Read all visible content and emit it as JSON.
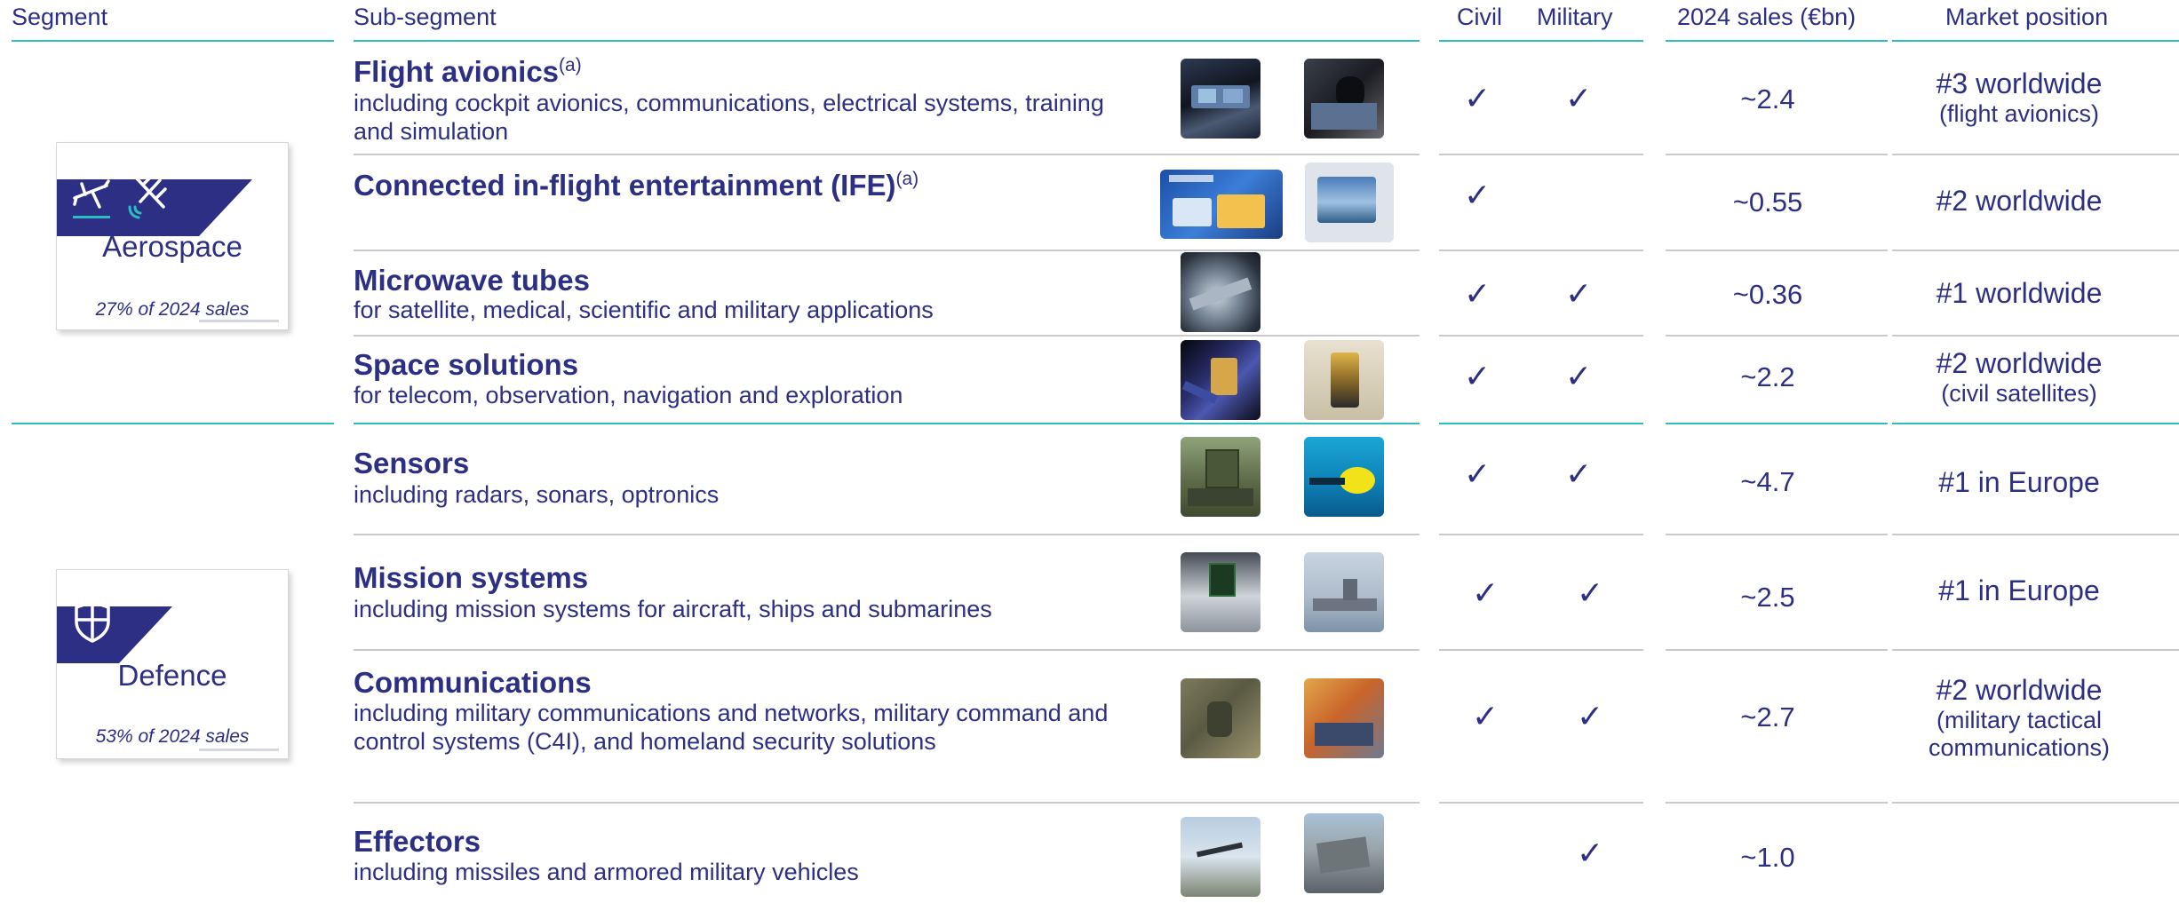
{
  "headers": {
    "segment": "Segment",
    "sub_segment": "Sub-segment",
    "civil": "Civil",
    "military": "Military",
    "sales": "2024 sales (€bn)",
    "market_position": "Market position"
  },
  "segments": [
    {
      "name": "Aerospace",
      "share": "27% of 2024 sales",
      "icons": [
        "airplane-icon",
        "satellite-icon"
      ]
    },
    {
      "name": "Defence",
      "share": "53% of 2024 sales",
      "icons": [
        "shield-icon"
      ]
    }
  ],
  "rows": [
    {
      "title": "Flight avionics",
      "sup": "(a)",
      "desc": "including cockpit avionics, communications, electrical systems, training and simulation",
      "civil": "✓",
      "military": "✓",
      "sales": "~2.4",
      "market": "#3 worldwide",
      "market_note": "(flight avionics)"
    },
    {
      "title": "Connected in-flight entertainment (IFE)",
      "sup": "(a)",
      "desc": "",
      "civil": "✓",
      "military": "",
      "sales": "~0.55",
      "market": "#2 worldwide",
      "market_note": ""
    },
    {
      "title": "Microwave tubes",
      "sup": "",
      "desc": "for satellite, medical, scientific and military applications",
      "civil": "✓",
      "military": "✓",
      "sales": "~0.36",
      "market": "#1 worldwide",
      "market_note": ""
    },
    {
      "title": "Space solutions",
      "sup": "",
      "desc": "for telecom, observation, navigation and exploration",
      "civil": "✓",
      "military": "✓",
      "sales": "~2.2",
      "market": "#2 worldwide",
      "market_note": "(civil satellites)"
    },
    {
      "title": "Sensors",
      "sup": "",
      "desc": "including radars, sonars, optronics",
      "civil": "✓",
      "military": "✓",
      "sales": "~4.7",
      "market": "#1 in Europe",
      "market_note": ""
    },
    {
      "title": "Mission systems",
      "sup": "",
      "desc": "including mission systems for aircraft, ships and submarines",
      "civil": "✓",
      "military": "✓",
      "sales": "~2.5",
      "market": "#1 in Europe",
      "market_note": ""
    },
    {
      "title": "Communications",
      "sup": "",
      "desc": "including military communications and networks, military command and control systems (C4I), and homeland security solutions",
      "civil": "✓",
      "military": "✓",
      "sales": "~2.7",
      "market": "#2 worldwide",
      "market_note": "(military tactical communications)"
    },
    {
      "title": "Effectors",
      "sup": "",
      "desc": "including missiles and armored military vehicles",
      "civil": "",
      "military": "✓",
      "sales": "~1.0",
      "market": "",
      "market_note": ""
    }
  ],
  "colors": {
    "navy": "#2c2f84",
    "teal": "#2bbdc2",
    "grey_rule": "#c9cacf"
  }
}
